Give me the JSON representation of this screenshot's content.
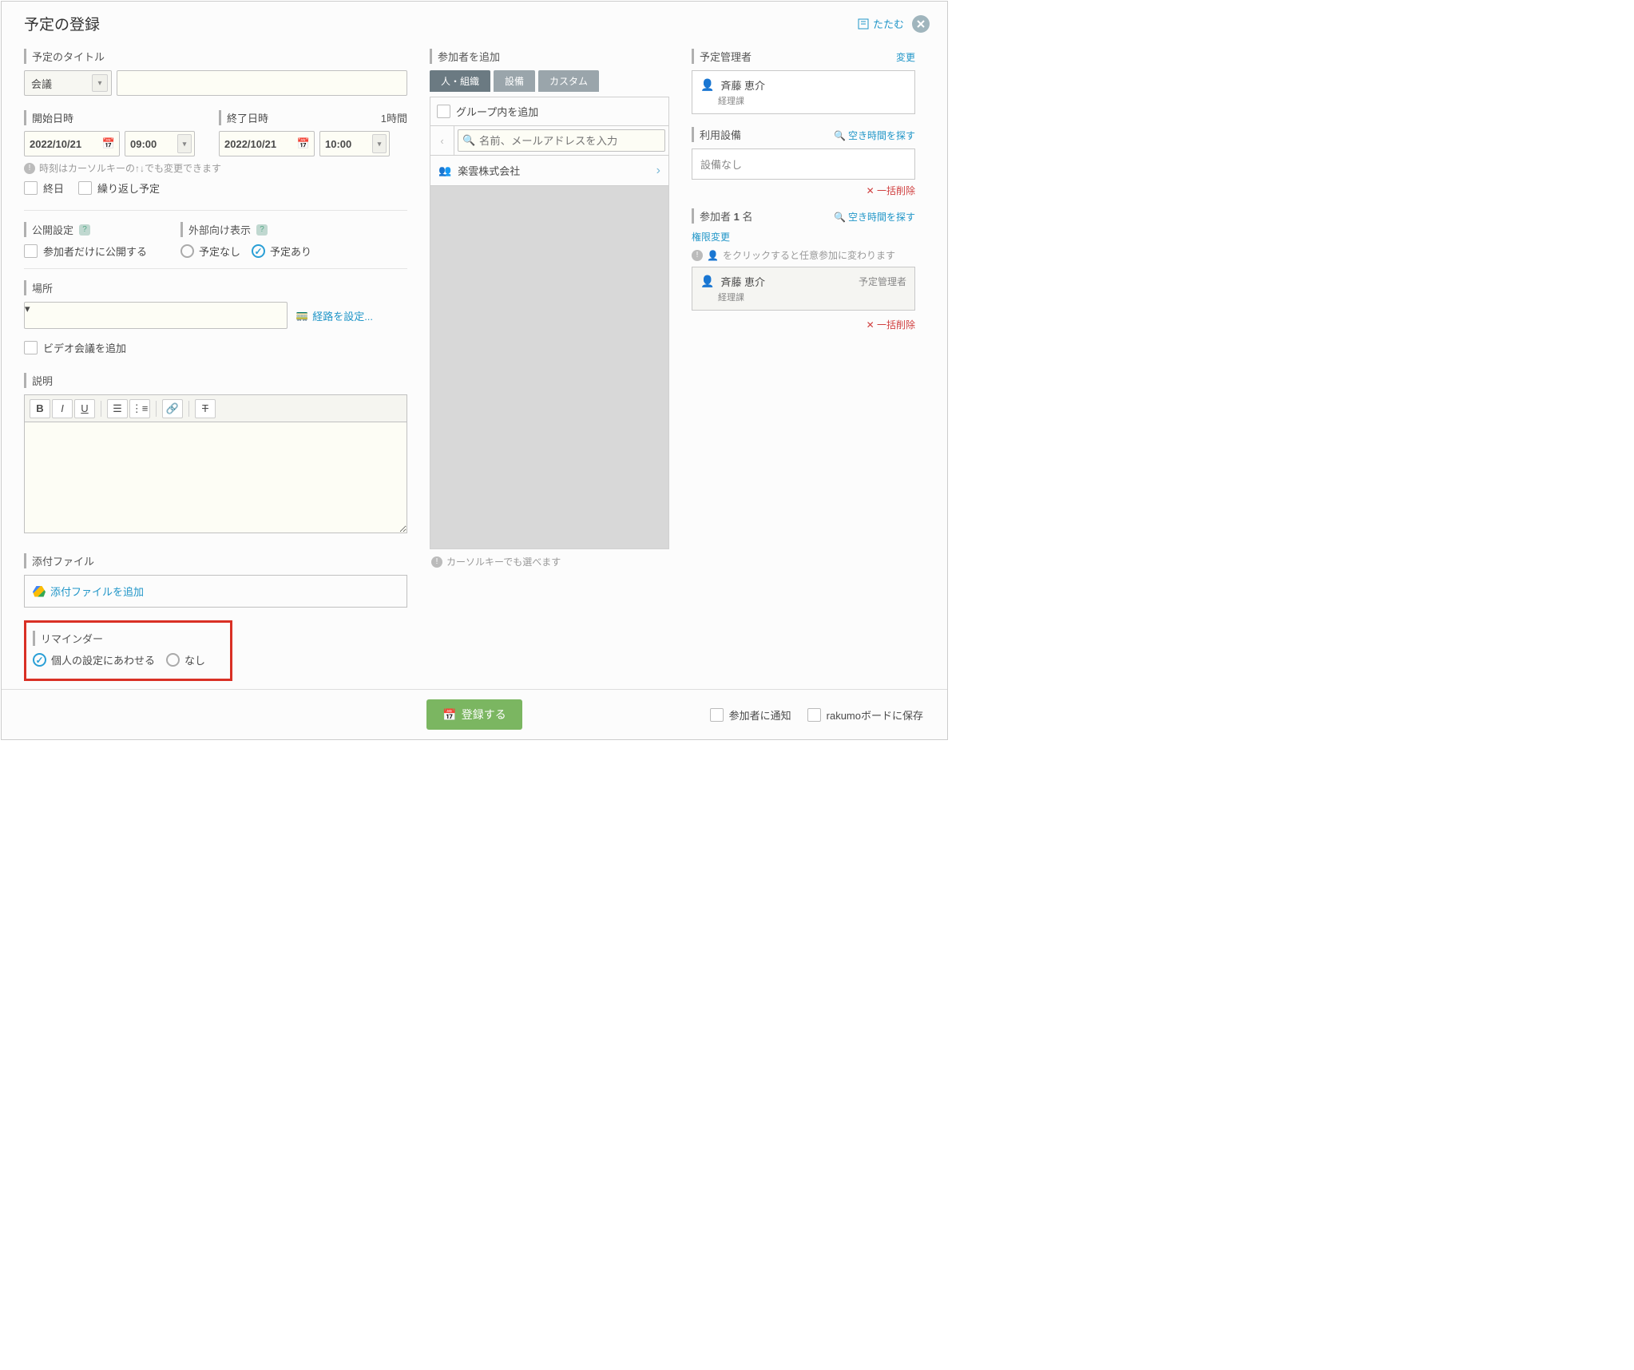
{
  "header": {
    "title": "予定の登録",
    "collapse": "たたむ"
  },
  "titleSection": {
    "label": "予定のタイトル",
    "type": "会議"
  },
  "startDate": {
    "label": "開始日時",
    "date": "2022/10/21",
    "time": "09:00"
  },
  "endDate": {
    "label": "終了日時",
    "date": "2022/10/21",
    "time": "10:00",
    "duration": "1時間"
  },
  "timeHint": "時刻はカーソルキーの↑↓でも変更できます",
  "allDay": "終日",
  "repeat": "繰り返し予定",
  "publicSetting": {
    "label": "公開設定",
    "option": "参加者だけに公開する"
  },
  "externalDisplay": {
    "label": "外部向け表示",
    "none": "予定なし",
    "has": "予定あり"
  },
  "location": {
    "label": "場所",
    "routeLink": "経路を設定..."
  },
  "videoMeeting": "ビデオ会議を追加",
  "description": {
    "label": "説明"
  },
  "attachment": {
    "label": "添付ファイル",
    "add": "添付ファイルを追加"
  },
  "reminder": {
    "label": "リマインダー",
    "personal": "個人の設定にあわせる",
    "none": "なし"
  },
  "participants": {
    "label": "参加者を追加",
    "tabs": {
      "people": "人・組織",
      "equipment": "設備",
      "custom": "カスタム"
    },
    "groupAdd": "グループ内を追加",
    "searchPlaceholder": "名前、メールアドレスを入力",
    "org": "楽雲株式会社",
    "cursorHint": "カーソルキーでも選べます"
  },
  "manager": {
    "label": "予定管理者",
    "change": "変更",
    "name": "斉藤 恵介",
    "dept": "経理課"
  },
  "equipment": {
    "label": "利用設備",
    "findTime": "空き時間を探す",
    "none": "設備なし",
    "deleteAll": "一括削除"
  },
  "participantList": {
    "label": "参加者",
    "count": "1",
    "countSuffix": "名",
    "findTime": "空き時間を探す",
    "permChange": "権限変更",
    "clickHint": "をクリックすると任意参加に変わります",
    "person": {
      "name": "斉藤 恵介",
      "dept": "経理課",
      "role": "予定管理者"
    },
    "deleteAll": "一括削除"
  },
  "footer": {
    "register": "登録する",
    "notify": "参加者に通知",
    "saveBoard": "rakumoボードに保存"
  }
}
